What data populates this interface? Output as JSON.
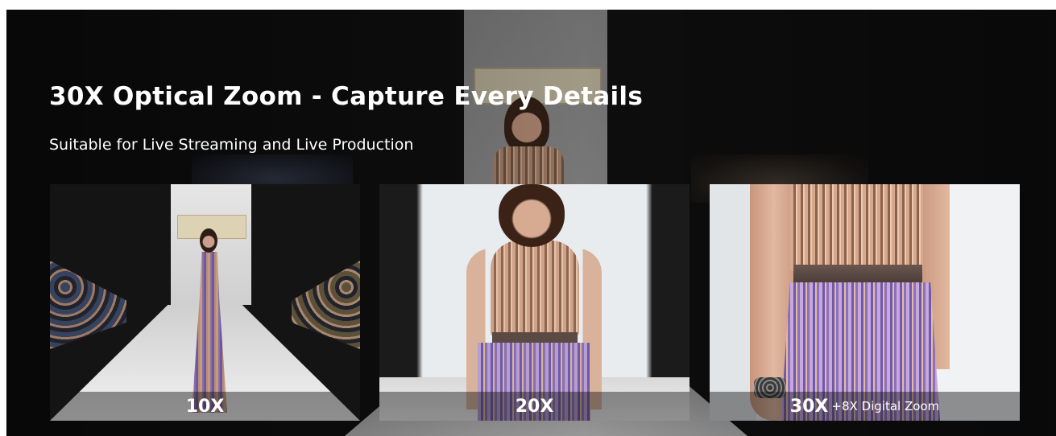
{
  "header": {
    "title": "30X Optical Zoom - Capture Every Details",
    "subtitle": "Suitable for Live Streaming and Live Production"
  },
  "panels": [
    {
      "zoom": "10X",
      "extra": "",
      "scene": "full-length runway shot"
    },
    {
      "zoom": "20X",
      "extra": "",
      "scene": "waist-up runway shot"
    },
    {
      "zoom": "30X",
      "extra": "+8X Digital Zoom",
      "scene": "close-up of dress"
    }
  ],
  "colors": {
    "background": "#111111",
    "text": "#ffffff",
    "label_band": "#141414"
  }
}
